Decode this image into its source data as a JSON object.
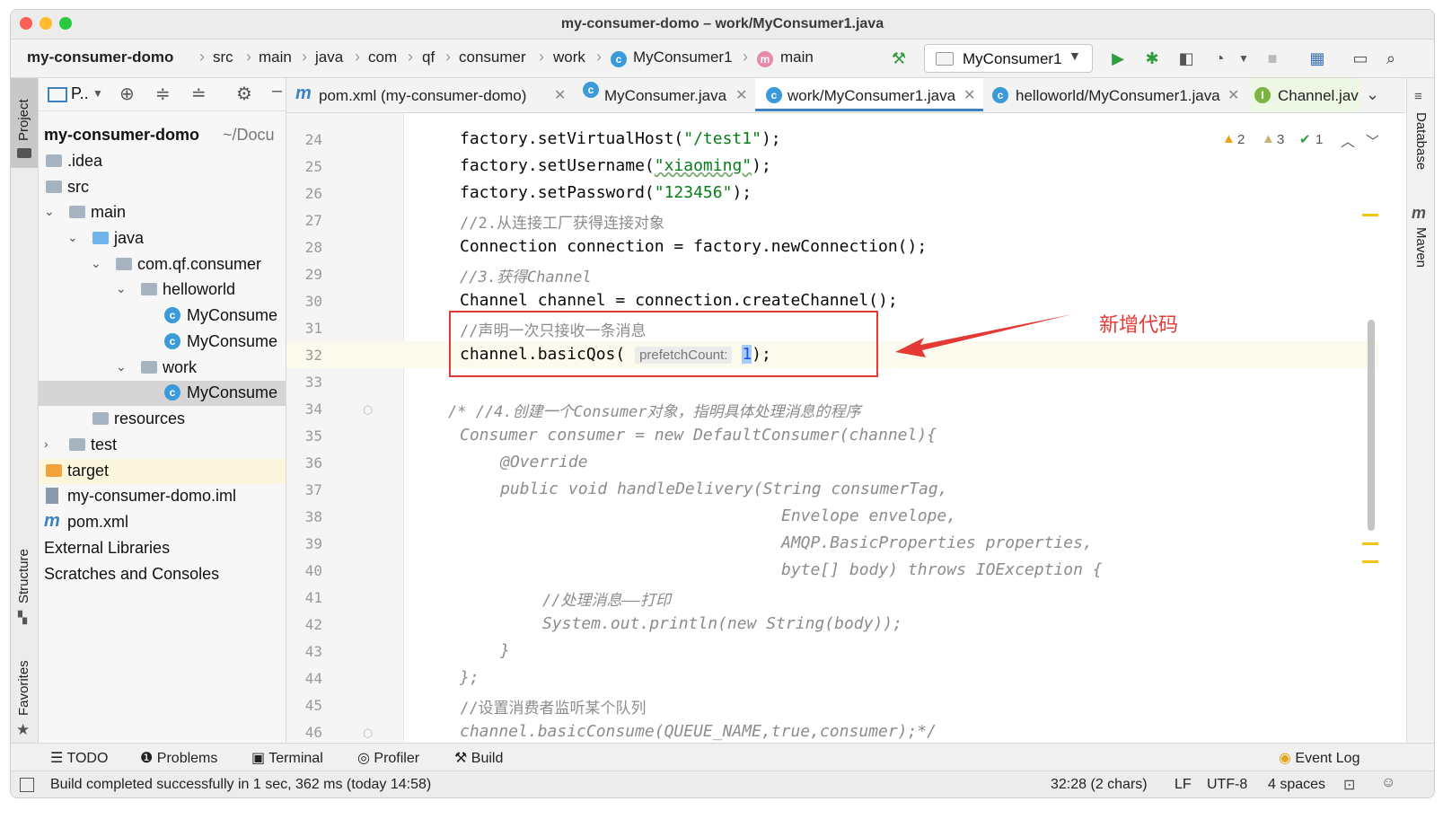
{
  "window": {
    "title": "my-consumer-domo – work/MyConsumer1.java"
  },
  "navbar": {
    "breadcrumbs": [
      "my-consumer-domo",
      "src",
      "main",
      "java",
      "com",
      "qf",
      "consumer",
      "work",
      "MyConsumer1",
      "main"
    ],
    "run_config": "MyConsumer1"
  },
  "left_stripe": {
    "project": "Project",
    "structure": "Structure",
    "favorites": "Favorites"
  },
  "right_stripe": {
    "database": "Database",
    "maven": "Maven"
  },
  "project_panel": {
    "header": "P..",
    "tree": [
      {
        "label": "my-consumer-domo",
        "suffix": "~/Docu",
        "bold": true
      },
      {
        "label": ".idea"
      },
      {
        "label": "src"
      },
      {
        "label": "main"
      },
      {
        "label": "java"
      },
      {
        "label": "com.qf.consumer"
      },
      {
        "label": "helloworld"
      },
      {
        "label": "MyConsume"
      },
      {
        "label": "MyConsume"
      },
      {
        "label": "work"
      },
      {
        "label": "MyConsume"
      },
      {
        "label": "resources"
      },
      {
        "label": "test"
      },
      {
        "label": "target"
      },
      {
        "label": "my-consumer-domo.iml"
      },
      {
        "label": "pom.xml"
      },
      {
        "label": "External Libraries"
      },
      {
        "label": "Scratches and Consoles"
      }
    ]
  },
  "tabs": [
    {
      "label": "pom.xml (my-consumer-domo)"
    },
    {
      "label": "MyConsumer.java"
    },
    {
      "label": "work/MyConsumer1.java"
    },
    {
      "label": "helloworld/MyConsumer1.java"
    },
    {
      "label": "Channel.jav"
    }
  ],
  "inspections": {
    "warn1": "2",
    "warn2": "3",
    "ok": "1"
  },
  "editor": {
    "line_numbers": [
      "24",
      "25",
      "26",
      "27",
      "28",
      "29",
      "30",
      "31",
      "32",
      "33",
      "34",
      "35",
      "36",
      "37",
      "38",
      "39",
      "40",
      "41",
      "42",
      "43",
      "44",
      "45",
      "46"
    ],
    "lines": {
      "l24a": "factory.setVirtualHost(",
      "l24s": "\"/test1\"",
      "l24b": ");",
      "l25a": "factory.setUsername(",
      "l25s": "\"xiaoming\"",
      "l25b": ");",
      "l26a": "factory.setPassword(",
      "l26s": "\"123456\"",
      "l26b": ");",
      "l27": "//2.从连接工厂获得连接对象",
      "l28": "Connection connection = factory.newConnection();",
      "l29": "//3.获得Channel",
      "l30": "Channel channel = connection.createChannel();",
      "l31": "//声明一次只接收一条消息",
      "l32a": "channel.basicQos(",
      "l32hint": "prefetchCount:",
      "l32val": "1",
      "l32b": ");",
      "l34": "/* //4.创建一个Consumer对象，指明具体处理消息的程序",
      "l35": "Consumer consumer = new DefaultConsumer(channel){",
      "l36": "@Override",
      "l37": "public void handleDelivery(String consumerTag,",
      "l38": "Envelope envelope,",
      "l39": "AMQP.BasicProperties properties,",
      "l40": "byte[] body) throws IOException {",
      "l41": "//处理消息——打印",
      "l42": "System.out.println(new String(body));",
      "l43": "}",
      "l44": "};",
      "l45": "//设置消费者监听某个队列",
      "l46": "channel.basicConsume(QUEUE_NAME,true,consumer);*/"
    },
    "annotation": "新增代码"
  },
  "bottom_tools": [
    "TODO",
    "Problems",
    "Terminal",
    "Profiler",
    "Build",
    "Event Log"
  ],
  "status": {
    "message": "Build completed successfully in 1 sec, 362 ms (today 14:58)",
    "position": "32:28 (2 chars)",
    "line_sep": "LF",
    "encoding": "UTF-8",
    "indent": "4 spaces"
  },
  "colors": {
    "annotation": "#e53935",
    "string": "#067d17",
    "comment": "#8c8c8c",
    "run_green": "#2e9d3e"
  }
}
